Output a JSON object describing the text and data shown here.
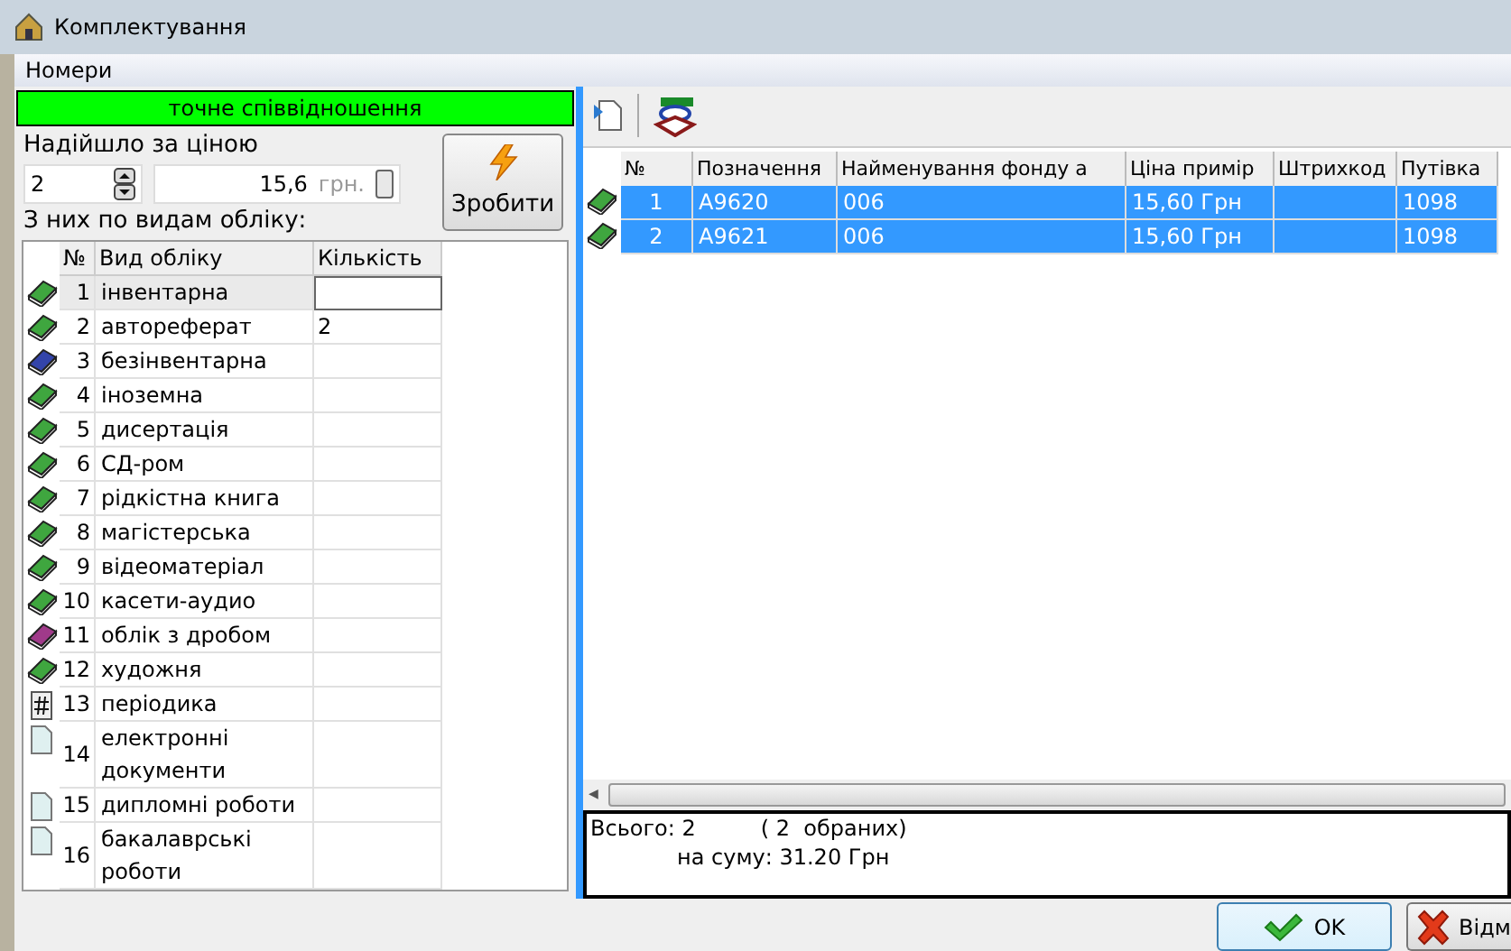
{
  "window": {
    "title": "Комплектування"
  },
  "menu": [
    "Номери"
  ],
  "status_banner": "точне співвідношення",
  "price_label": "Надійшло за ціною",
  "count_value": "2",
  "price_value": "15,6",
  "currency": "грн.",
  "make_button": "Зробити",
  "breakdown_label": "З них по видам обліку:",
  "types_table": {
    "columns": [
      "№",
      "Вид обліку",
      "Кількість"
    ],
    "rows": [
      {
        "kind": "book",
        "color": "#3fa63f",
        "num": "1",
        "name": "інвентарна",
        "qty": "",
        "selected": true
      },
      {
        "kind": "book",
        "color": "#3fa63f",
        "num": "2",
        "name": "автореферат",
        "qty": "2",
        "selected": false
      },
      {
        "kind": "book",
        "color": "#3344aa",
        "num": "3",
        "name": "безінвентарна",
        "qty": "",
        "selected": false
      },
      {
        "kind": "book",
        "color": "#3fa63f",
        "num": "4",
        "name": "іноземна",
        "qty": "",
        "selected": false
      },
      {
        "kind": "book",
        "color": "#3fa63f",
        "num": "5",
        "name": "дисертація",
        "qty": "",
        "selected": false
      },
      {
        "kind": "book",
        "color": "#3fa63f",
        "num": "6",
        "name": "СД-ром",
        "qty": "",
        "selected": false
      },
      {
        "kind": "book",
        "color": "#3fa63f",
        "num": "7",
        "name": "рідкістна книга",
        "qty": "",
        "selected": false
      },
      {
        "kind": "book",
        "color": "#3fa63f",
        "num": "8",
        "name": "магістерська",
        "qty": "",
        "selected": false
      },
      {
        "kind": "book",
        "color": "#3fa63f",
        "num": "9",
        "name": "відеоматеріал",
        "qty": "",
        "selected": false
      },
      {
        "kind": "book",
        "color": "#3fa63f",
        "num": "10",
        "name": "касети-аудио",
        "qty": "",
        "selected": false
      },
      {
        "kind": "book",
        "color": "#a03a8a",
        "num": "11",
        "name": "облік з дробом",
        "qty": "",
        "selected": false
      },
      {
        "kind": "book",
        "color": "#3fa63f",
        "num": "12",
        "name": "художня",
        "qty": "",
        "selected": false
      },
      {
        "kind": "hash",
        "num": "13",
        "name": "періодика",
        "qty": "",
        "selected": false
      },
      {
        "kind": "page",
        "num": "14",
        "name": "електронні документи",
        "qty": "",
        "selected": false
      },
      {
        "kind": "page",
        "num": "15",
        "name": "дипломні роботи",
        "qty": "",
        "selected": false
      },
      {
        "kind": "page",
        "num": "16",
        "name": "бакалаврські роботи",
        "qty": "",
        "selected": false
      }
    ]
  },
  "scroll_arrow": "◀",
  "items_table": {
    "columns": [
      "№",
      "Позначення",
      "Найменування фонду а",
      "Ціна примір",
      "Штрихкод",
      "Путівка"
    ],
    "rows": [
      {
        "selected": true,
        "cells": [
          "1",
          "А9620",
          "006",
          "15,60 Грн",
          "",
          "1098"
        ]
      },
      {
        "selected": true,
        "cells": [
          "2",
          "А9621",
          "006",
          "15,60 Грн",
          "",
          "1098"
        ]
      }
    ]
  },
  "summary": {
    "total": "Всього: 2",
    "chosen": "( 2  обраних)",
    "sum": "на суму: 31.20 Грн"
  },
  "buttons": {
    "ok": "OK",
    "cancel": "Відм"
  }
}
